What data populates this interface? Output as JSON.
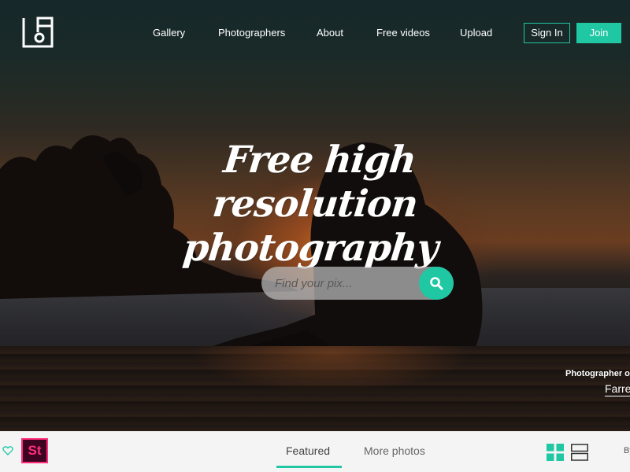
{
  "nav": {
    "links": [
      "Gallery",
      "Photographers",
      "About",
      "Free videos",
      "Upload"
    ],
    "sign_in": "Sign In",
    "join": "Join"
  },
  "hero": {
    "headline_line1": "Free high resolution",
    "headline_line2": "photography",
    "search_placeholder": "Find your pix...",
    "credit_label": "Photographer of",
    "credit_name": "Farre"
  },
  "bottom": {
    "badge": "St",
    "tabs": [
      "Featured",
      "More photos"
    ],
    "active_tab": "Featured",
    "by_text": "By"
  },
  "colors": {
    "accent": "#1fc7a3",
    "badge_bg": "#3d0320",
    "badge_fg": "#ff2d7a"
  },
  "icons": [
    "logo-icon",
    "search-icon",
    "heart-icon",
    "grid-view-icon",
    "list-view-icon"
  ]
}
